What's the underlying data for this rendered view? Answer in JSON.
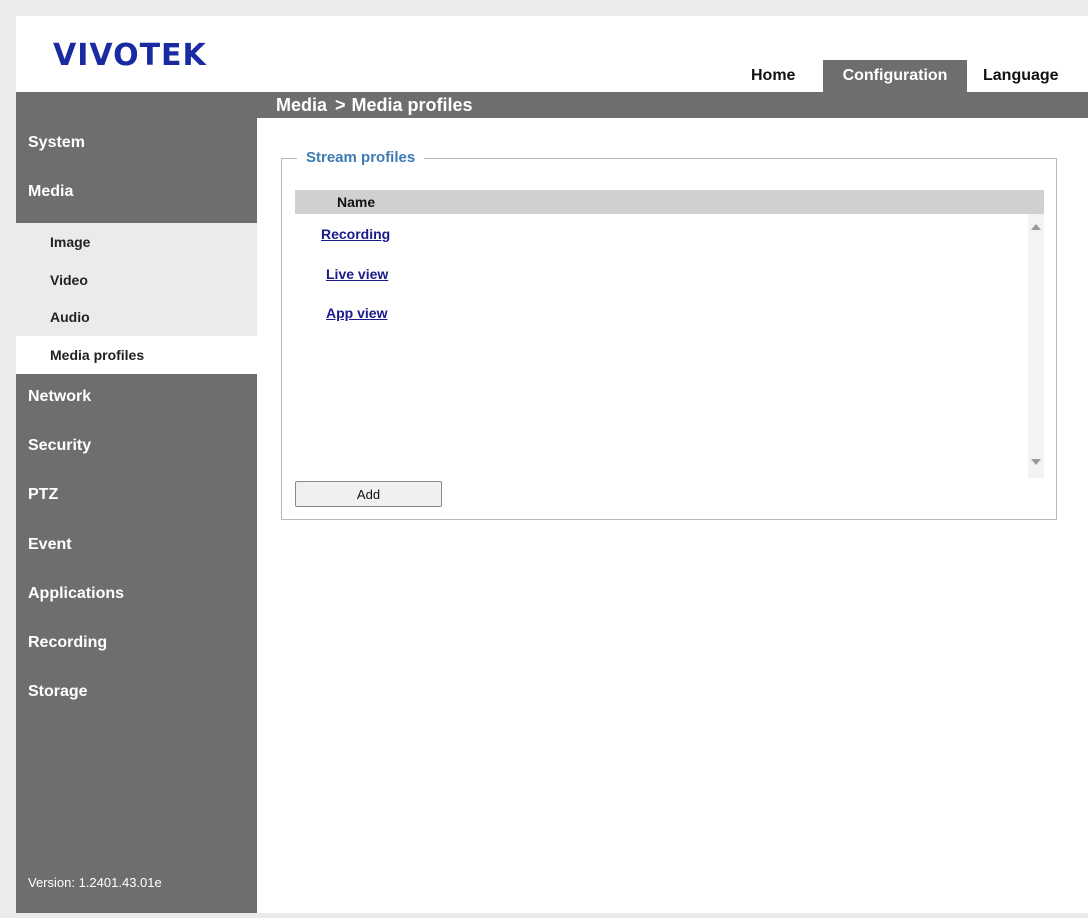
{
  "header": {
    "logo": "VIVOTEK",
    "tabs": [
      {
        "label": "Home"
      },
      {
        "label": "Configuration",
        "active": true
      },
      {
        "label": "Language"
      }
    ]
  },
  "breadcrumb": {
    "section": "Media",
    "separator": ">",
    "page": "Media profiles"
  },
  "sidebar": {
    "items": [
      {
        "label": "System"
      },
      {
        "label": "Media",
        "expanded": true
      },
      {
        "label": "Network"
      },
      {
        "label": "Security"
      },
      {
        "label": "PTZ"
      },
      {
        "label": "Event"
      },
      {
        "label": "Applications"
      },
      {
        "label": "Recording"
      },
      {
        "label": "Storage"
      }
    ],
    "media_subitems": [
      {
        "label": "Image"
      },
      {
        "label": "Video"
      },
      {
        "label": "Audio"
      },
      {
        "label": "Media profiles",
        "selected": true
      }
    ],
    "version": "Version: 1.2401.43.01e"
  },
  "stream_profiles": {
    "legend": "Stream profiles",
    "column_header": "Name",
    "profiles": [
      "Recording",
      "Live view",
      "App view"
    ],
    "add_label": "Add"
  },
  "colors": {
    "logo": "#1a2aa0",
    "bar": "#6e6e6e",
    "legend": "#3d7bb5",
    "link": "#1a1a8c"
  }
}
